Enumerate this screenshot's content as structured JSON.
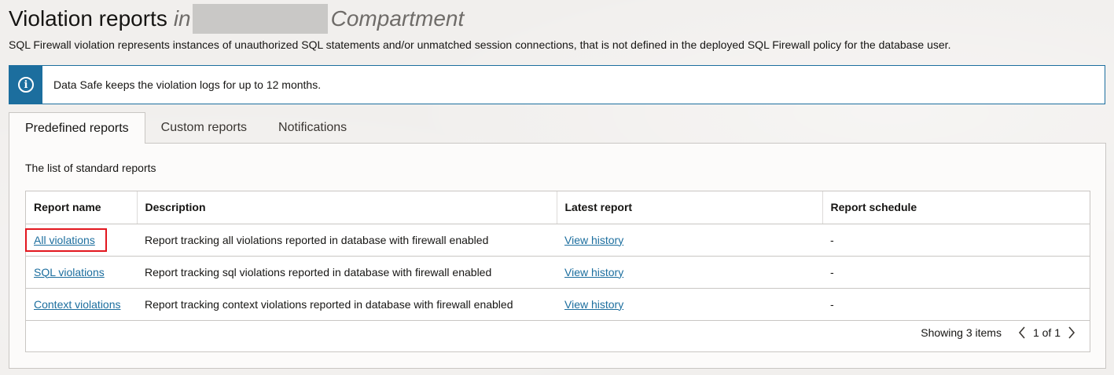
{
  "header": {
    "title": "Violation reports",
    "title_in": "in",
    "title_compartment": "Compartment",
    "description": "SQL Firewall violation represents instances of unauthorized SQL statements and/or unmatched session connections, that is not defined in the deployed SQL Firewall policy for the database user."
  },
  "banner": {
    "icon": "info-icon",
    "text": "Data Safe keeps the violation logs for up to 12 months."
  },
  "tabs": [
    {
      "label": "Predefined reports",
      "active": true
    },
    {
      "label": "Custom reports",
      "active": false
    },
    {
      "label": "Notifications",
      "active": false
    }
  ],
  "panel": {
    "subtitle": "The list of standard reports"
  },
  "table": {
    "columns": [
      "Report name",
      "Description",
      "Latest report",
      "Report schedule"
    ],
    "rows": [
      {
        "name": "All violations",
        "description": "Report tracking all violations reported in database with firewall enabled",
        "latest": "View history",
        "schedule": "-"
      },
      {
        "name": "SQL violations",
        "description": "Report tracking sql violations reported in database with firewall enabled",
        "latest": "View history",
        "schedule": "-"
      },
      {
        "name": "Context violations",
        "description": "Report tracking context violations reported in database with firewall enabled",
        "latest": "View history",
        "schedule": "-"
      }
    ]
  },
  "pagination": {
    "showing": "Showing 3 items",
    "page_info": "1 of 1"
  },
  "colors": {
    "accent": "#1c6e9e",
    "highlight": "#e2161e"
  }
}
